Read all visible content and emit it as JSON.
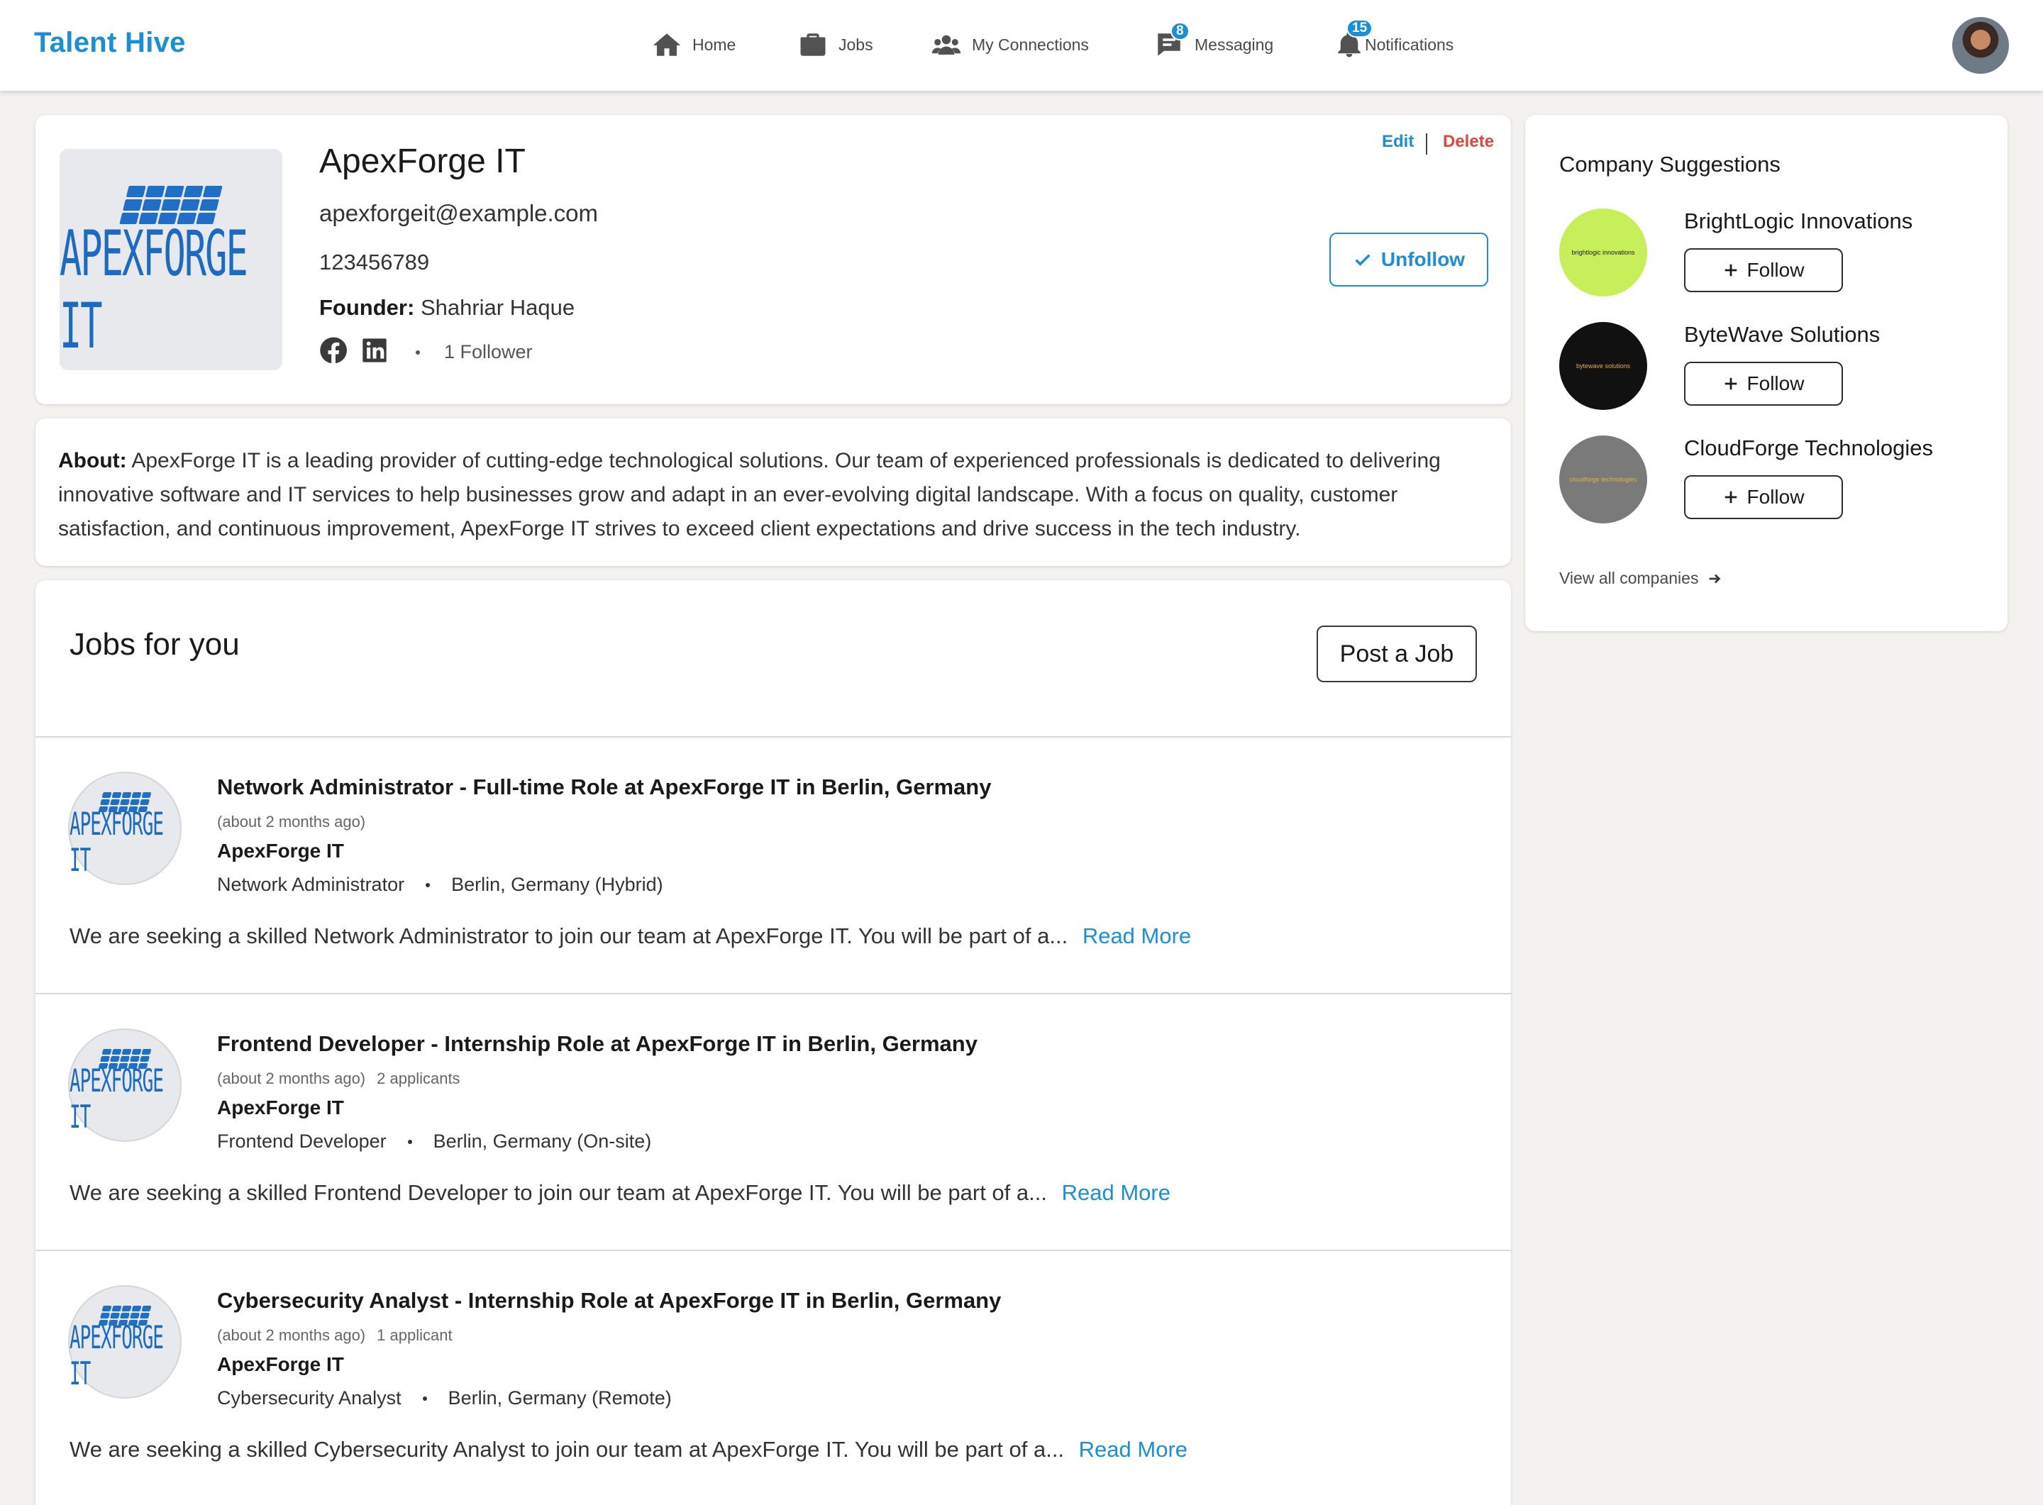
{
  "app": {
    "brand": "Talent Hive"
  },
  "nav": {
    "items": [
      {
        "label": "Home",
        "icon": "home-icon"
      },
      {
        "label": "Jobs",
        "icon": "briefcase-icon"
      },
      {
        "label": "My Connections",
        "icon": "connections-icon"
      },
      {
        "label": "Messaging",
        "icon": "message-icon",
        "badge": "8"
      },
      {
        "label": "Notifications",
        "icon": "bell-icon",
        "badge": "15"
      }
    ],
    "accent": "#1a8fd8"
  },
  "company": {
    "name": "ApexForge IT",
    "logo_text": "APEXFORGE IT",
    "email": "apexforgeit@example.com",
    "phone": "123456789",
    "founder_label": "Founder:",
    "founder": "Shahriar Haque",
    "followers": "1 Follower",
    "edit_label": "Edit",
    "delete_label": "Delete",
    "unfollow_label": "Unfollow"
  },
  "about": {
    "label": "About:",
    "text": "ApexForge IT is a leading provider of cutting-edge technological solutions. Our team of experienced professionals is dedicated to delivering innovative software and IT services to help businesses grow and adapt in an ever-evolving digital landscape. With a focus on quality, customer satisfaction, and continuous improvement, ApexForge IT strives to exceed client expectations and drive success in the tech industry."
  },
  "jobs": {
    "title": "Jobs for you",
    "post_label": "Post a Job",
    "read_more_label": "Read More",
    "items": [
      {
        "title": "Network Administrator - Full-time Role at ApexForge IT in Berlin, Germany",
        "posted": "(about 2 months ago)",
        "applicants": "",
        "company": "ApexForge IT",
        "role": "Network Administrator",
        "location": "Berlin, Germany (Hybrid)",
        "description": "We are seeking a skilled Network Administrator to join our team at ApexForge IT. You will be part of a..."
      },
      {
        "title": "Frontend Developer - Internship Role at ApexForge IT in Berlin, Germany",
        "posted": "(about 2 months ago)",
        "applicants": "2 applicants",
        "company": "ApexForge IT",
        "role": "Frontend Developer",
        "location": "Berlin, Germany (On-site)",
        "description": "We are seeking a skilled Frontend Developer to join our team at ApexForge IT. You will be part of a..."
      },
      {
        "title": "Cybersecurity Analyst - Internship Role at ApexForge IT in Berlin, Germany",
        "posted": "(about 2 months ago)",
        "applicants": "1 applicant",
        "company": "ApexForge IT",
        "role": "Cybersecurity Analyst",
        "location": "Berlin, Germany (Remote)",
        "description": "We are seeking a skilled Cybersecurity Analyst to join our team at ApexForge IT. You will be part of a..."
      }
    ]
  },
  "suggestions": {
    "title": "Company Suggestions",
    "follow_label": "Follow",
    "view_all_label": "View all companies",
    "items": [
      {
        "name": "BrightLogic Innovations",
        "logo_text": "brightlogic innovations",
        "logo_bg": "#c7ef5a",
        "logo_fg": "#1a1a1a"
      },
      {
        "name": "ByteWave Solutions",
        "logo_text": "bytewave solutions",
        "logo_bg": "#111111",
        "logo_fg": "#e0b040"
      },
      {
        "name": "CloudForge Technologies",
        "logo_text": "cloudforge technologies",
        "logo_bg": "#7a7a7a",
        "logo_fg": "#e0b040"
      }
    ]
  }
}
